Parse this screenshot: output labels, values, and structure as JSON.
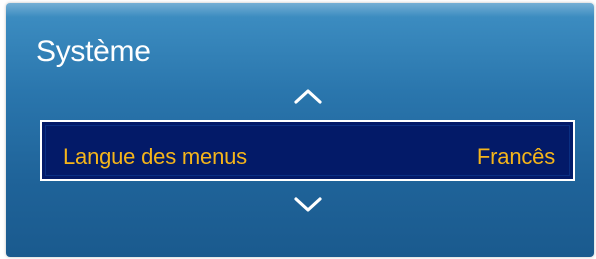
{
  "menu": {
    "title": "Système",
    "selected_item": {
      "label": "Langue des menus",
      "value": "Francês"
    },
    "nav_icons": {
      "up": "chevron-up-icon",
      "down": "chevron-down-icon"
    }
  },
  "colors": {
    "panel": "#2a76ad",
    "highlight_bg": "#031a68",
    "highlight_text": "#f5b51a",
    "title_text": "#ffffff"
  }
}
